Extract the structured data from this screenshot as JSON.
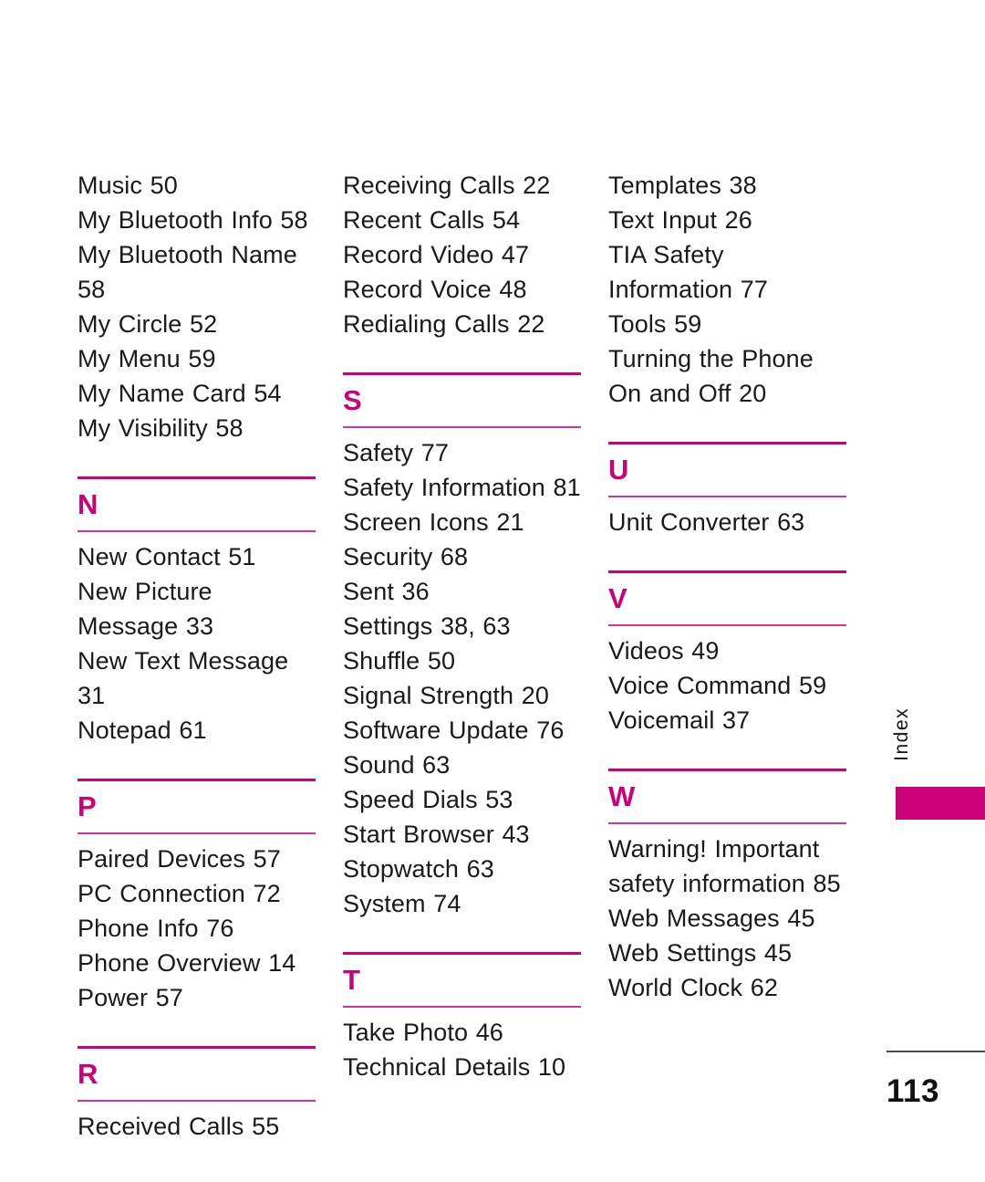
{
  "document": {
    "page_number": "113",
    "tab_label": "Index",
    "accent_color": "#cc0077",
    "rule_color": "#d5339b",
    "text_color": "#1a1a1a",
    "footer_rule_color": "#4a4a4a"
  },
  "columns": [
    {
      "id": "column-1",
      "blocks": [
        {
          "type": "entries",
          "items": [
            "Music 50",
            "My Bluetooth Info 58",
            "My Bluetooth Name 58",
            "My Circle 52",
            "My Menu 59",
            "My Name Card 54",
            "My Visibility 58"
          ]
        },
        {
          "type": "section",
          "letter": "N",
          "items": [
            "New Contact 51",
            "New Picture Message 33",
            "New Text Message 31",
            "Notepad 61"
          ]
        },
        {
          "type": "section",
          "letter": "P",
          "items": [
            "Paired Devices 57",
            "PC Connection 72",
            "Phone Info 76",
            "Phone Overview 14",
            "Power 57"
          ]
        },
        {
          "type": "section",
          "letter": "R",
          "items": [
            "Received Calls 55"
          ]
        }
      ]
    },
    {
      "id": "column-2",
      "blocks": [
        {
          "type": "entries",
          "items": [
            "Receiving Calls 22",
            "Recent Calls 54",
            "Record Video 47",
            "Record Voice 48",
            "Redialing Calls 22"
          ]
        },
        {
          "type": "section",
          "letter": "S",
          "items": [
            "Safety 77",
            "Safety Information 81",
            "Screen Icons 21",
            "Security 68",
            "Sent 36",
            "Settings 38, 63",
            "Shuffle 50",
            "Signal Strength 20",
            "Software Update 76",
            "Sound 63",
            "Speed Dials 53",
            "Start Browser 43",
            "Stopwatch 63",
            "System 74"
          ]
        },
        {
          "type": "section",
          "letter": "T",
          "items": [
            "Take Photo 46",
            "Technical Details 10"
          ]
        }
      ]
    },
    {
      "id": "column-3",
      "blocks": [
        {
          "type": "entries",
          "items": [
            "Templates 38",
            "Text Input 26",
            "TIA Safety Information 77",
            "Tools 59",
            "Turning the Phone On and Off 20"
          ]
        },
        {
          "type": "section",
          "letter": "U",
          "items": [
            "Unit Converter 63"
          ]
        },
        {
          "type": "section",
          "letter": "V",
          "items": [
            "Videos 49",
            "Voice Command 59",
            "Voicemail 37"
          ]
        },
        {
          "type": "section",
          "letter": "W",
          "items": [
            "Warning! Important safety information 85",
            "Web Messages 45",
            "Web Settings 45",
            "World Clock 62"
          ]
        }
      ]
    }
  ]
}
